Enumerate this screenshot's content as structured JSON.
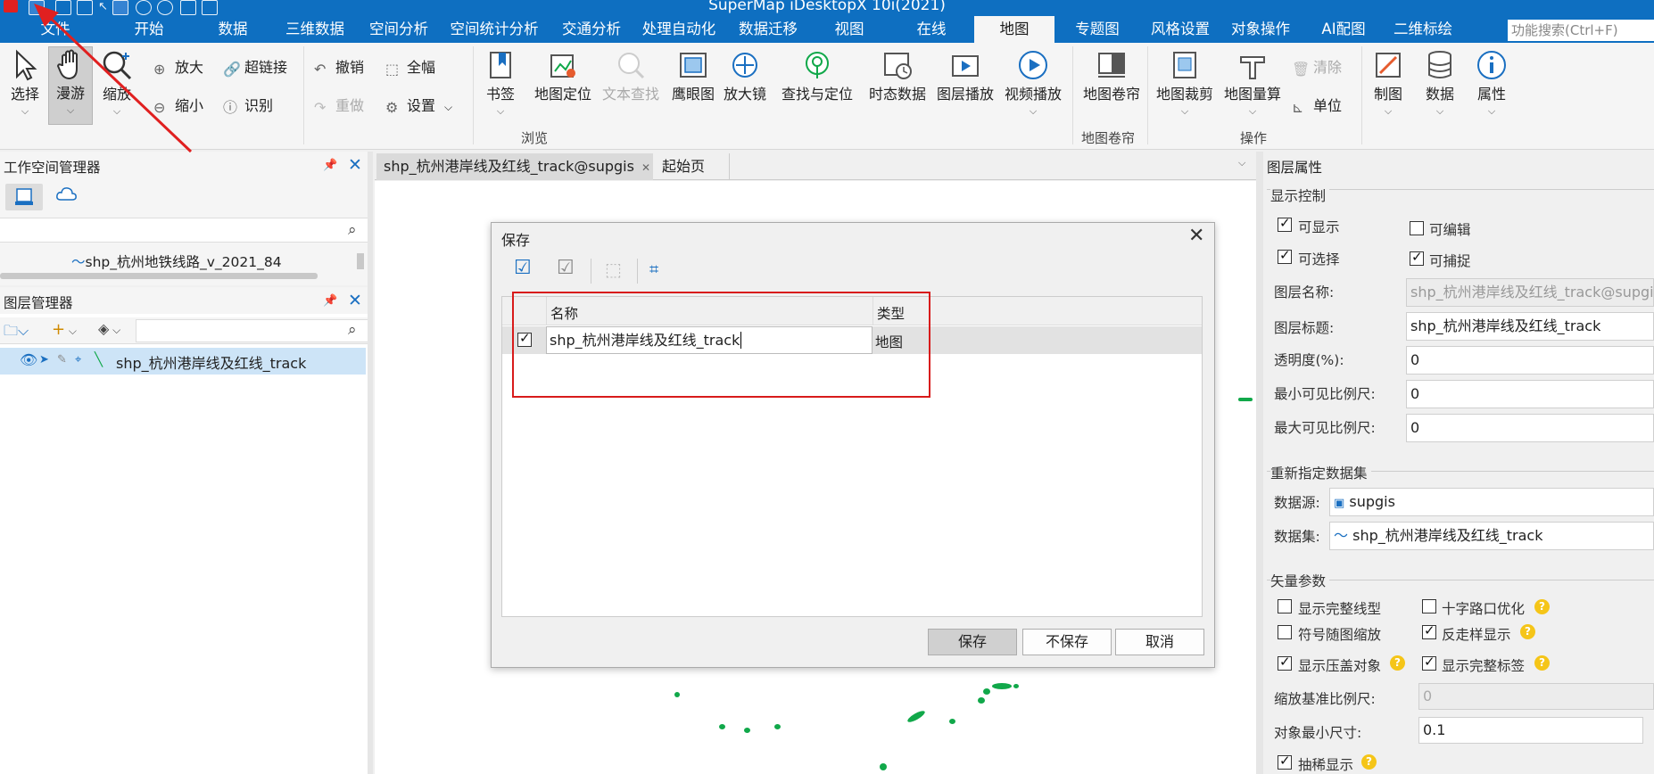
{
  "window": {
    "title": "SuperMap iDesktopX 10i(2021)"
  },
  "menu": {
    "file": "文件",
    "items": [
      "开始",
      "数据",
      "三维数据",
      "空间分析",
      "空间统计分析",
      "交通分析",
      "处理自动化",
      "数据迁移",
      "视图",
      "在线",
      "地图",
      "专题图",
      "风格设置",
      "对象操作",
      "AI配图",
      "二维标绘"
    ],
    "search_placeholder": "功能搜索(Ctrl+F)"
  },
  "ribbon": {
    "select": "选择",
    "pan": "漫游",
    "zoom": "缩放",
    "zoom_in": "放大",
    "zoom_out": "缩小",
    "hyperlink": "超链接",
    "identify": "识别",
    "undo": "撤销",
    "redo": "重做",
    "full_extent": "全幅",
    "settings": "设置",
    "bookmark": "书签",
    "map_locate": "地图定位",
    "text_find": "文本查找",
    "eagle_eye": "鹰眼图",
    "magnifier": "放大镜",
    "find_locate": "查找与定位",
    "temporal": "时态数据",
    "layer_play": "图层播放",
    "video_play": "视频播放",
    "map_swipe": "地图卷帘",
    "map_clip": "地图裁剪",
    "map_measure": "地图量算",
    "clear": "清除",
    "unit": "单位",
    "cartography": "制图",
    "data": "数据",
    "properties": "属性",
    "group_browse": "浏览",
    "group_swipe": "地图卷帘",
    "group_operation": "操作"
  },
  "workspace": {
    "title": "工作空间管理器",
    "tree_item": "shp_杭州地铁线路_v_2021_84"
  },
  "layer_manager": {
    "title": "图层管理器",
    "layer_name": "shp_杭州港岸线及红线_track"
  },
  "tabs": {
    "map_tab": "shp_杭州港岸线及红线_track@supgis",
    "start_tab": "起始页"
  },
  "dialog": {
    "title": "保存",
    "col_name": "名称",
    "col_type": "类型",
    "row_name": "shp_杭州港岸线及红线_track",
    "row_type": "地图",
    "save": "保存",
    "dont_save": "不保存",
    "cancel": "取消"
  },
  "props": {
    "title": "图层属性",
    "display_control": "显示控制",
    "visible": "可显示",
    "editable": "可编辑",
    "selectable": "可选择",
    "snappable": "可捕捉",
    "layer_name_label": "图层名称:",
    "layer_name_value": "shp_杭州港岸线及红线_track@supgis",
    "layer_caption_label": "图层标题:",
    "layer_caption_value": "shp_杭州港岸线及红线_track",
    "transparency_label": "透明度(%):",
    "transparency_value": "0",
    "min_scale_label": "最小可见比例尺:",
    "min_scale_value": "0",
    "max_scale_label": "最大可见比例尺:",
    "max_scale_value": "0",
    "reassign": "重新指定数据集",
    "datasource_label": "数据源:",
    "datasource_value": "supgis",
    "dataset_label": "数据集:",
    "dataset_value": "shp_杭州港岸线及红线_track",
    "vector_params": "矢量参数",
    "full_linetype": "显示完整线型",
    "cross_opt": "十字路口优化",
    "symbol_scale": "符号随图缩放",
    "antialias": "反走样显示",
    "overlap": "显示压盖对象",
    "full_label": "显示完整标签",
    "ref_scale_label": "缩放基准比例尺:",
    "ref_scale_value": "0",
    "min_size_label": "对象最小尺寸:",
    "min_size_value": "0.1",
    "thin_display": "抽稀显示"
  }
}
